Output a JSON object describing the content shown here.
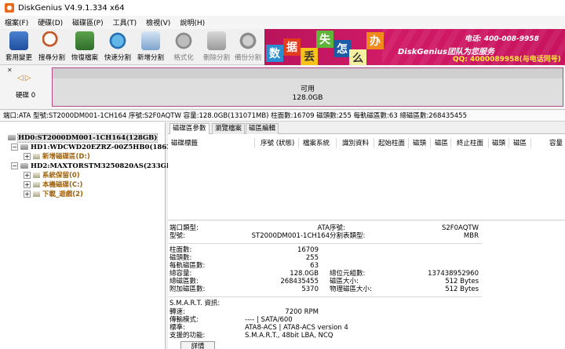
{
  "window": {
    "title": "DiskGenius V4.9.1.334 x64"
  },
  "menu": [
    "檔案(F)",
    "硬碟(D)",
    "磁碟區(P)",
    "工具(T)",
    "檢視(V)",
    "說明(H)"
  ],
  "toolbar": [
    {
      "label": "套用變更",
      "icon": "save-icon",
      "enabled": true
    },
    {
      "label": "搜尋分割",
      "icon": "search-icon",
      "enabled": true
    },
    {
      "label": "恢復檔案",
      "icon": "restore-icon",
      "enabled": true
    },
    {
      "label": "快速分割",
      "icon": "quick-partition-icon",
      "enabled": true
    },
    {
      "label": "新增分割",
      "icon": "new-partition-icon",
      "enabled": true
    },
    {
      "label": "格式化",
      "icon": "format-icon",
      "enabled": false
    },
    {
      "label": "刪除分割",
      "icon": "delete-partition-icon",
      "enabled": false
    },
    {
      "label": "備份分割",
      "icon": "backup-partition-icon",
      "enabled": false
    }
  ],
  "banner": {
    "chars": [
      "数",
      "据",
      "丢",
      "失",
      "怎",
      "么",
      "办"
    ],
    "brand": "DiskGenius团队为您服务",
    "phone": "电话: 400-008-9958",
    "qq": "QQ: 4000089958(与电话同号)"
  },
  "diskmap": {
    "disk_label": "硬碟 0",
    "free_label": "可用",
    "free_size": "128.0GB"
  },
  "infoline": "端口:ATA  型號:ST2000DM001-1CH164  序號:S2F0AQTW  容量:128.0GB(131071MB)  柱面數:16709  磁頭數:255  每軌磁區數:63  總磁區數:268435455",
  "tree": {
    "hd0": "HD0:ST2000DM001-1CH164(128GB)",
    "hd1": "HD1:WDCWD20EZRZ-00Z5HB0(1863G",
    "hd1_p1": "新增磁碟區(D:)",
    "hd2": "HD2:MAXTORSTM3250820AS(233GB)",
    "hd2_p1": "系統保留(0)",
    "hd2_p2": "本機磁碟(C:)",
    "hd2_p3": "下載_遊戲(2)"
  },
  "tabs": [
    "磁碟區參數",
    "瀏覽檔案",
    "磁區編輯"
  ],
  "grid_columns": [
    "磁碟標籤",
    "序號 (狀態)",
    "檔案系統",
    "識別資料",
    "起始柱面",
    "磁頭",
    "磁區",
    "終止柱面",
    "磁頭",
    "磁區",
    "容量"
  ],
  "props": {
    "port_type_label": "端口類型:",
    "port_type": "ATA",
    "serial_label": "序號:",
    "serial": "S2F0AQTW",
    "model_label": "型號:",
    "model": "ST2000DM001-1CH164",
    "part_table_label": "分割表類型:",
    "part_table": "MBR",
    "cylinders_label": "柱面數:",
    "cylinders": "16709",
    "heads_label": "磁頭數:",
    "heads": "255",
    "sectors_track_label": "每軌磁區數:",
    "sectors_track": "63",
    "capacity_label": "總容量:",
    "capacity": "128.0GB",
    "total_bytes_label": "總位元組數:",
    "total_bytes": "137438952960",
    "total_sectors_label": "總磁區數:",
    "total_sectors": "268435455",
    "sector_size_label": "磁區大小:",
    "sector_size": "512 Bytes",
    "extra_sectors_label": "附加磁區數:",
    "extra_sectors": "5370",
    "physical_sector_label": "物理磁區大小:",
    "physical_sector": "512 Bytes",
    "smart_label": "S.M.A.R.T. 資訊:",
    "rpm_label": "轉速:",
    "rpm": "7200 RPM",
    "transfer_label": "傳輸模式:",
    "transfer": "---- | SATA/600",
    "standard_label": "標準:",
    "standard": "ATA8-ACS | ATA8-ACS version 4",
    "features_label": "支援的功能:",
    "features": "S.M.A.R.T., 48bit LBA, NCQ",
    "detail_button": "詳情"
  }
}
